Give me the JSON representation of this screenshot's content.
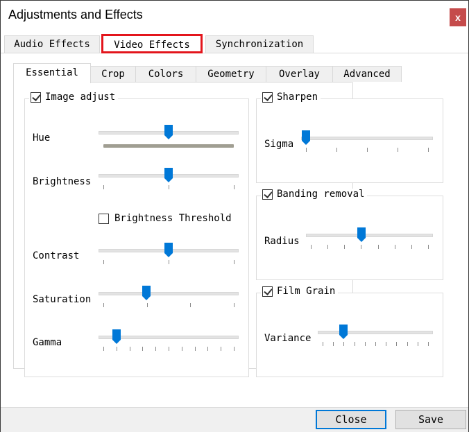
{
  "window": {
    "title": "Adjustments and Effects",
    "close_glyph": "x"
  },
  "top_tabs": [
    {
      "label": "Audio Effects",
      "active": false
    },
    {
      "label": "Video Effects",
      "active": true,
      "highlighted": true
    },
    {
      "label": "Synchronization",
      "active": false
    }
  ],
  "inner_tabs": [
    {
      "label": "Essential",
      "active": true
    },
    {
      "label": "Crop",
      "active": false
    },
    {
      "label": "Colors",
      "active": false
    },
    {
      "label": "Geometry",
      "active": false
    },
    {
      "label": "Overlay",
      "active": false
    },
    {
      "label": "Advanced",
      "active": false
    }
  ],
  "image_adjust": {
    "title": "Image adjust",
    "checked": true,
    "sliders": {
      "hue": {
        "label": "Hue",
        "value": 0.5,
        "ticks": 0
      },
      "brightness": {
        "label": "Brightness",
        "value": 0.5,
        "ticks": 3
      },
      "contrast": {
        "label": "Contrast",
        "value": 0.5,
        "ticks": 3
      },
      "saturation": {
        "label": "Saturation",
        "value": 0.33,
        "ticks": 4
      },
      "gamma": {
        "label": "Gamma",
        "value": 0.1,
        "ticks": 11
      }
    },
    "brightness_threshold": {
      "label": "Brightness Threshold",
      "checked": false
    }
  },
  "sharpen": {
    "title": "Sharpen",
    "checked": true,
    "slider": {
      "label": "Sigma",
      "value": 0.0,
      "ticks": 5
    }
  },
  "banding_removal": {
    "title": "Banding removal",
    "checked": true,
    "slider": {
      "label": "Radius",
      "value": 0.43,
      "ticks": 8
    }
  },
  "film_grain": {
    "title": "Film Grain",
    "checked": true,
    "slider": {
      "label": "Variance",
      "value": 0.2,
      "ticks": 11
    }
  },
  "buttons": {
    "close": "Close",
    "save": "Save"
  },
  "colors": {
    "thumb": "#0078d7",
    "highlight": "#e3151c",
    "close_bg": "#c54b4b"
  }
}
